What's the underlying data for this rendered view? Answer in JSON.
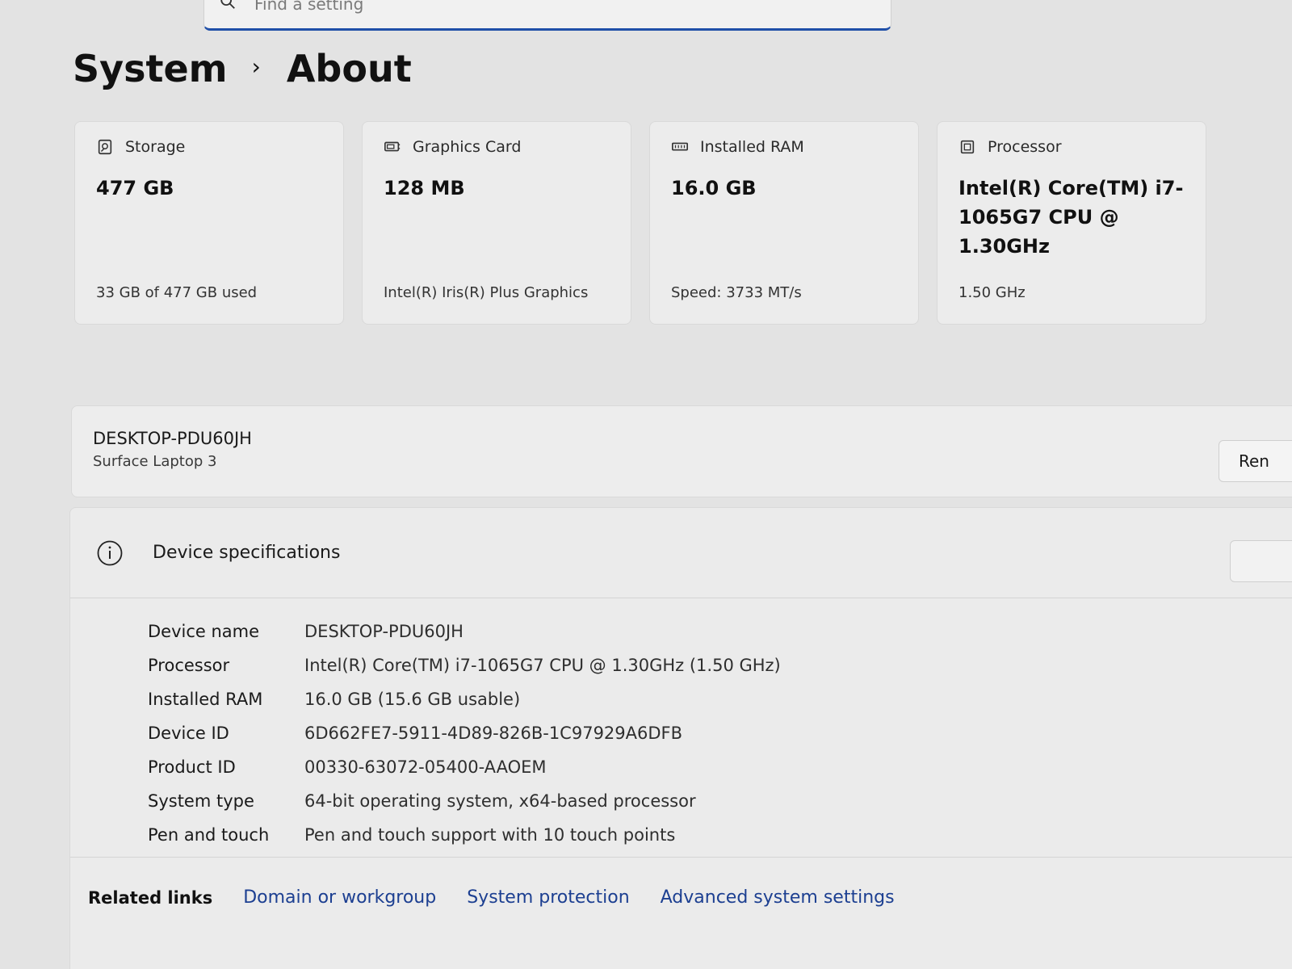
{
  "search": {
    "placeholder": "Find a setting"
  },
  "breadcrumb": {
    "parent": "System",
    "separator": "›",
    "current": "About"
  },
  "cards": [
    {
      "icon": "storage-icon",
      "label": "Storage",
      "value": "477 GB",
      "sub": "33 GB of 477 GB used"
    },
    {
      "icon": "graphics-card-icon",
      "label": "Graphics Card",
      "value": "128 MB",
      "sub": "Intel(R) Iris(R) Plus Graphics"
    },
    {
      "icon": "ram-icon",
      "label": "Installed RAM",
      "value": "16.0 GB",
      "sub": "Speed: 3733 MT/s"
    },
    {
      "icon": "processor-icon",
      "label": "Processor",
      "value": "Intel(R) Core(TM) i7-1065G7 CPU @ 1.30GHz",
      "sub": "1.50 GHz"
    }
  ],
  "device": {
    "name": "DESKTOP-PDU60JH",
    "model": "Surface Laptop 3",
    "rename_label": "Ren"
  },
  "specs": {
    "title": "Device specifications",
    "rows": [
      {
        "label": "Device name",
        "value": "DESKTOP-PDU60JH"
      },
      {
        "label": "Processor",
        "value": "Intel(R) Core(TM) i7-1065G7 CPU @ 1.30GHz (1.50 GHz)"
      },
      {
        "label": "Installed RAM",
        "value": "16.0 GB (15.6 GB usable)"
      },
      {
        "label": "Device ID",
        "value": "6D662FE7-5911-4D89-826B-1C97929A6DFB"
      },
      {
        "label": "Product ID",
        "value": "00330-63072-05400-AAOEM"
      },
      {
        "label": "System type",
        "value": "64-bit operating system, x64-based processor"
      },
      {
        "label": "Pen and touch",
        "value": "Pen and touch support with 10 touch points"
      }
    ]
  },
  "related": {
    "label": "Related links",
    "links": [
      "Domain or workgroup",
      "System protection",
      "Advanced system settings"
    ]
  }
}
